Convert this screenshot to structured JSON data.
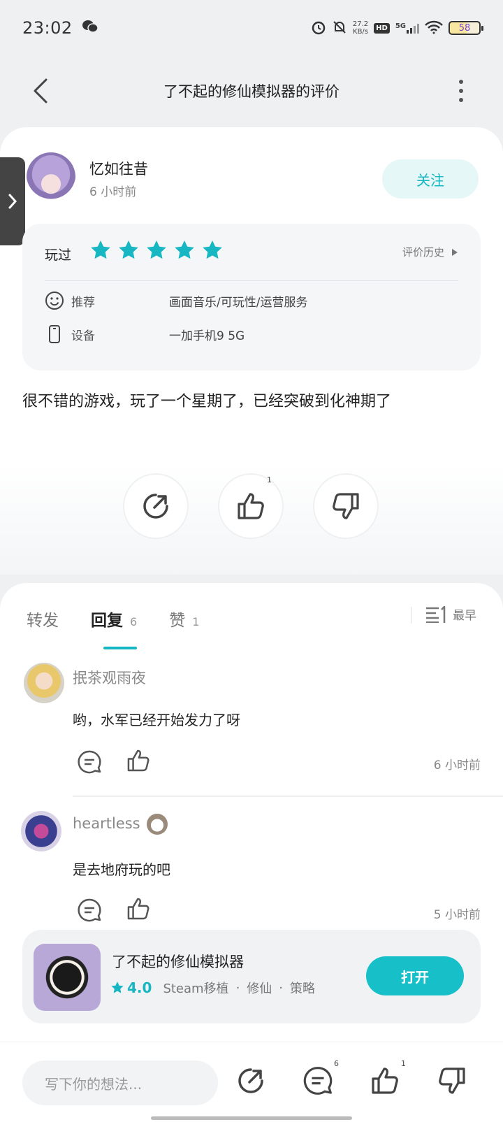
{
  "status_bar": {
    "time": "23:02",
    "net_speed_value": "27.2",
    "net_speed_unit": "KB/s",
    "hd_label": "HD",
    "network_label": "5G",
    "battery": "58"
  },
  "nav": {
    "title": "了不起的修仙模拟器的评价"
  },
  "review": {
    "user_name": "忆如往昔",
    "time_ago": "6 小时前",
    "follow_label": "关注",
    "played_label": "玩过",
    "rating": 5,
    "history_label": "评价历史",
    "recommend_label": "推荐",
    "recommend_value": "画面音乐/可玩性/运营服务",
    "device_label": "设备",
    "device_value": "一加手机9 5G",
    "text": "很不错的游戏，玩了一个星期了，已经突破到化神期了",
    "like_count": "1"
  },
  "tabs": [
    {
      "label": "转发",
      "count": ""
    },
    {
      "label": "回复",
      "count": "6"
    },
    {
      "label": "赞",
      "count": "1"
    }
  ],
  "sort_label": "最早",
  "comments": [
    {
      "name": "抿茶观雨夜",
      "text": "哟，水军已经开始发力了呀",
      "time": "6 小时前"
    },
    {
      "name": "heartless",
      "text": "是去地府玩的吧",
      "time": "5 小时前"
    }
  ],
  "app": {
    "name": "了不起的修仙模拟器",
    "score": "4.0",
    "tags": [
      "Steam移植",
      "修仙",
      "策略"
    ],
    "open_label": "打开"
  },
  "bottom_bar": {
    "placeholder": "写下你的想法...",
    "reply_count": "6",
    "like_count": "1"
  },
  "colors": {
    "accent": "#17b6c3",
    "background": "#eef0f2"
  }
}
